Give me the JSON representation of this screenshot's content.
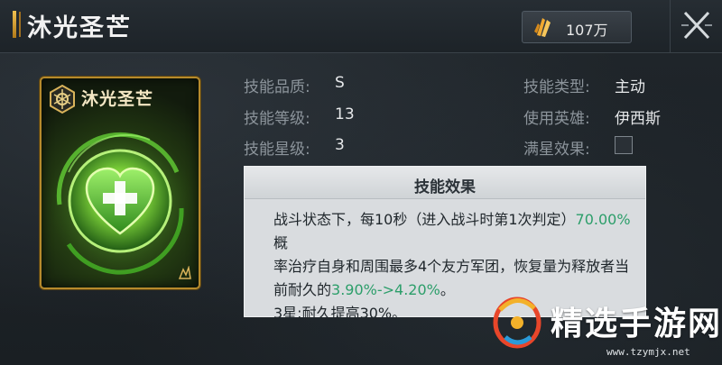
{
  "header": {
    "title": "沐光圣芒",
    "currency_value": "107万"
  },
  "card": {
    "title": "沐光圣芒"
  },
  "stats": [
    {
      "label": "技能品质:",
      "value": "S"
    },
    {
      "label": "技能等级:",
      "value": "13"
    },
    {
      "label": "技能星级:",
      "value": "3"
    },
    {
      "label": "技能类型:",
      "value": "主动"
    },
    {
      "label": "使用英雄:",
      "value": "伊西斯"
    },
    {
      "label": "满星效果:",
      "value": ""
    }
  ],
  "effect": {
    "title": "技能效果",
    "line1_a": "战斗状态下，每10秒（进入战斗时第1次判定）",
    "line1_hl": "70.00%",
    "line1_b": "概",
    "line2": "率治疗自身和周围最多4个友方军团，恢复量为释放者当",
    "line3_a": "前耐久的",
    "line3_hl": "3.90%->4.20%",
    "line3_b": "。",
    "line4": "3星:耐久提高30%。"
  },
  "watermark": {
    "text": "精选手游网",
    "url": "www.tzymjx.net"
  },
  "colors": {
    "highlight": "#2c9e6a",
    "gold": "#b68a2c"
  },
  "icons": [
    "currency-crystal-icon",
    "close-icon",
    "skill-emblem-icon",
    "heart-cross-icon",
    "star-corner-icon"
  ]
}
